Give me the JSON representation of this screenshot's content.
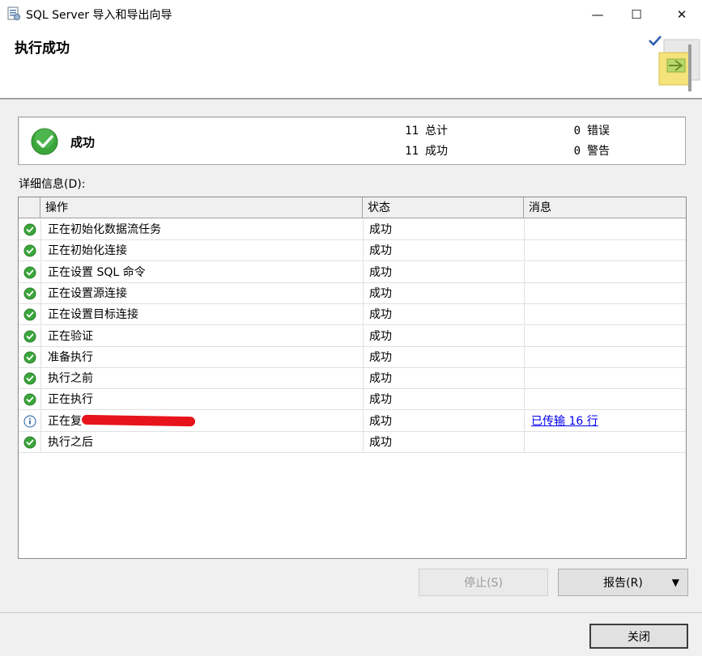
{
  "window": {
    "title": "SQL Server 导入和导出向导",
    "minimize_glyph": "—",
    "maximize_glyph": "☐",
    "close_glyph": "✕"
  },
  "header": {
    "title": "执行成功"
  },
  "summary": {
    "status": "成功",
    "total_count": "11",
    "total_label": "总计",
    "success_count": "11",
    "success_label": "成功",
    "error_count": "0",
    "error_label": "错误",
    "warning_count": "0",
    "warning_label": "警告"
  },
  "details_label": "详细信息(D):",
  "grid": {
    "columns": [
      "操作",
      "状态",
      "消息"
    ],
    "rows": [
      {
        "icon": "success-icon",
        "op": "正在初始化数据流任务",
        "status": "成功",
        "msg": ""
      },
      {
        "icon": "success-icon",
        "op": "正在初始化连接",
        "status": "成功",
        "msg": ""
      },
      {
        "icon": "success-icon",
        "op": "正在设置 SQL 命令",
        "status": "成功",
        "msg": ""
      },
      {
        "icon": "success-icon",
        "op": "正在设置源连接",
        "status": "成功",
        "msg": ""
      },
      {
        "icon": "success-icon",
        "op": "正在设置目标连接",
        "status": "成功",
        "msg": ""
      },
      {
        "icon": "success-icon",
        "op": "正在验证",
        "status": "成功",
        "msg": ""
      },
      {
        "icon": "success-icon",
        "op": "准备执行",
        "status": "成功",
        "msg": ""
      },
      {
        "icon": "success-icon",
        "op": "执行之前",
        "status": "成功",
        "msg": ""
      },
      {
        "icon": "success-icon",
        "op": "正在执行",
        "status": "成功",
        "msg": ""
      },
      {
        "icon": "info-icon",
        "op": "正在复",
        "status": "成功",
        "msg": "已传输 16 行"
      },
      {
        "icon": "success-icon",
        "op": "执行之后",
        "status": "成功",
        "msg": ""
      }
    ]
  },
  "buttons": {
    "stop": "停止(S)",
    "report": "报告(R)",
    "report_arrow": "▼",
    "close": "关闭"
  },
  "colors": {
    "success_green": "#3aa63a",
    "info_blue": "#1e5aa8",
    "link_blue": "#0000ee",
    "redaction_red": "#e8141b"
  }
}
